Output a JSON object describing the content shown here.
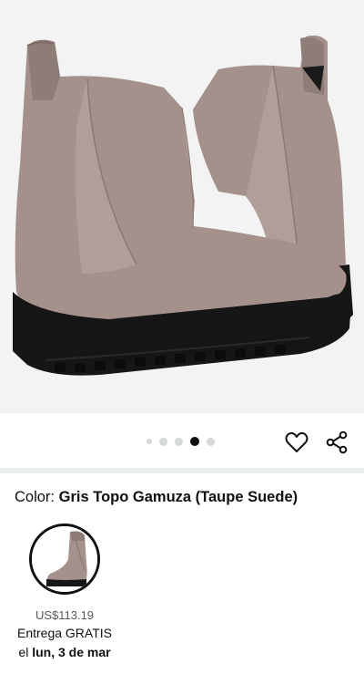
{
  "gallery": {
    "image_alt": "Taupe suede chelsea boots",
    "dot_count": 5,
    "active_index": 3
  },
  "color": {
    "label": "Color: ",
    "value": "Gris Topo Gamuza (Taupe Suede)"
  },
  "variant": {
    "price": "US$113.19",
    "delivery_line1": "Entrega GRATIS",
    "delivery_prefix": "el ",
    "delivery_date": "lun, 3 de mar"
  },
  "colors": {
    "suede": "#a4918b",
    "suede_shadow": "#8e7c76",
    "elastic": "#b09e98",
    "sole": "#161616",
    "background": "#f3f3f3",
    "divider": "#eaeded"
  },
  "icons": {
    "wishlist": "heart-outline-icon",
    "share": "share-icon"
  }
}
